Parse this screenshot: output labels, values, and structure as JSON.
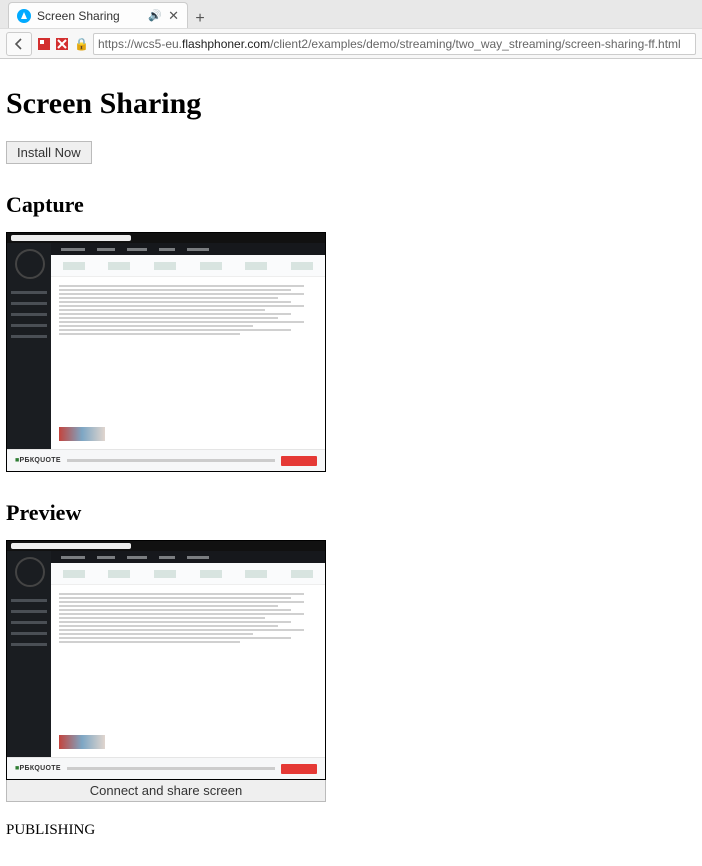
{
  "browser": {
    "tab_title": "Screen Sharing",
    "url_proto": "https://",
    "url_pre_host": "wcs5-eu.",
    "url_host": "flashphoner.com",
    "url_path": "/client2/examples/demo/streaming/two_way_streaming/screen-sharing-ff.html"
  },
  "page": {
    "title": "Screen Sharing",
    "install_button": "Install Now",
    "capture_heading": "Capture",
    "preview_heading": "Preview",
    "connect_button": "Connect and share screen",
    "status": "PUBLISHING",
    "captured_brand": "РБК",
    "captured_footer_brand": "РБКQUOTE"
  }
}
